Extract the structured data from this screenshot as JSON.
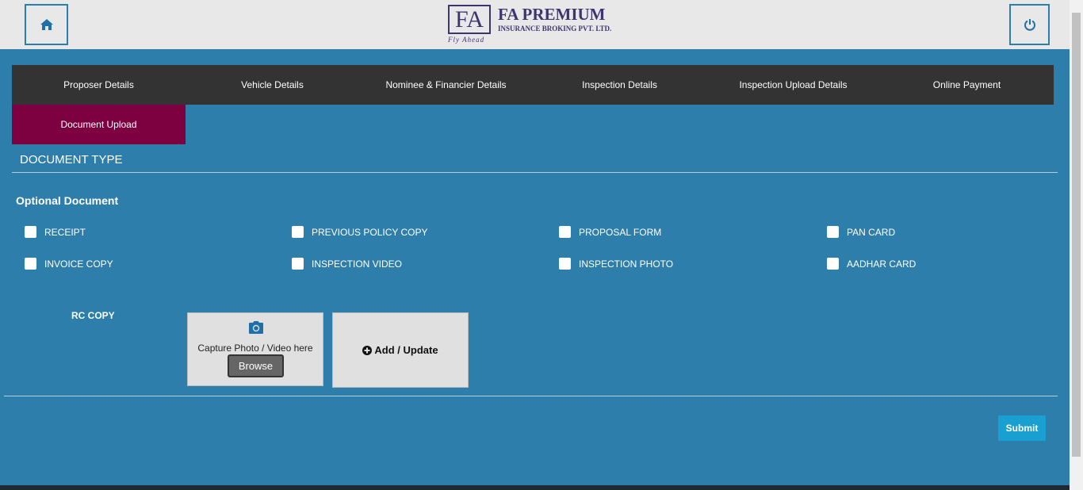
{
  "header": {
    "logo": {
      "mark": "FA",
      "name": "FA PREMIUM",
      "subtitle": "INSURANCE BROKING PVT. LTD.",
      "tagline": "Fly Ahead"
    },
    "home_icon": "home-icon",
    "power_icon": "power-icon"
  },
  "tabs": [
    {
      "label": "Proposer Details"
    },
    {
      "label": "Vehicle Details"
    },
    {
      "label": "Nominee & Financier Details"
    },
    {
      "label": "Inspection Details"
    },
    {
      "label": "Inspection Upload Details"
    },
    {
      "label": "Online Payment"
    },
    {
      "label": "Document Upload",
      "active": true
    }
  ],
  "section_title": "DOCUMENT TYPE",
  "optional_heading": "Optional Document",
  "documents": [
    {
      "label": "RECEIPT"
    },
    {
      "label": "PREVIOUS POLICY COPY"
    },
    {
      "label": "PROPOSAL FORM"
    },
    {
      "label": "PAN CARD"
    },
    {
      "label": "INVOICE COPY"
    },
    {
      "label": "INSPECTION VIDEO"
    },
    {
      "label": "INSPECTION PHOTO"
    },
    {
      "label": "AADHAR CARD"
    }
  ],
  "upload": {
    "doc_label": "RC COPY",
    "capture_text": "Capture Photo / Video here",
    "browse_label": "Browse",
    "add_label": "Add / Update"
  },
  "submit_label": "Submit",
  "colors": {
    "background": "#2d7eab",
    "tabbar": "#333333",
    "active_tab": "#7d0040",
    "submit": "#1a9fd1"
  }
}
